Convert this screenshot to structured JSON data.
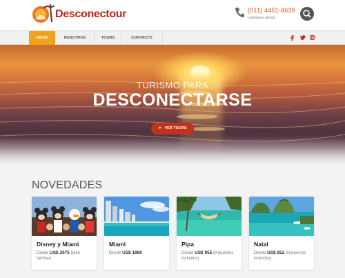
{
  "header": {
    "logo_text": "Desconectour",
    "phone_number": "(011) 4451-4639",
    "phone_sub": "Llamanos ahora"
  },
  "nav": {
    "items": [
      {
        "label": "INICIO"
      },
      {
        "label": "NOSOTROS"
      },
      {
        "label": "TOURS"
      },
      {
        "label": "CONTACTO"
      }
    ],
    "social": [
      "f",
      "t",
      "ig"
    ]
  },
  "hero": {
    "kicker": "TURISMO PARA",
    "title": "DESCONECTARSE",
    "button": "VER TOURS"
  },
  "news": {
    "title": "NOVEDADES",
    "cards": [
      {
        "title": "Disney y Miami",
        "desc_prefix": "Desde ",
        "price": "US$ 2675",
        "desc_suffix": " (plan familiar)"
      },
      {
        "title": "Miami",
        "desc_prefix": "Desde ",
        "price": "US$ 1880",
        "desc_suffix": ""
      },
      {
        "title": "Pipa",
        "desc_prefix": "Desde ",
        "price": "US$ 955",
        "desc_suffix": " (impuestos incluidos)"
      },
      {
        "title": "Natal",
        "desc_prefix": "Desde ",
        "price": "US$ 852",
        "desc_suffix": " (impuestos incluidos)"
      }
    ]
  },
  "colors": {
    "accent": "#f0a31a",
    "brand": "#c0251b",
    "button": "#c0321b"
  }
}
